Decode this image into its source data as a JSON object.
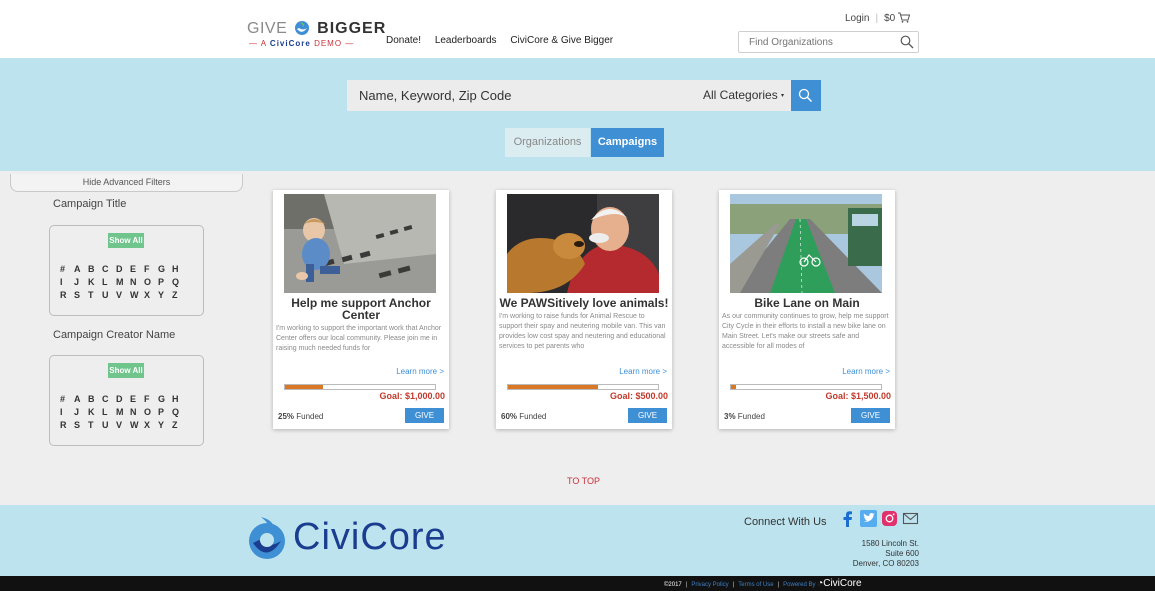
{
  "header": {
    "logo": {
      "give": "GIVE",
      "bigger": "BIGGER",
      "subtitle_prefix": "A",
      "subtitle_brand": "CiviCore",
      "subtitle_suffix": "DEMO"
    },
    "nav": [
      "Donate!",
      "Leaderboards",
      "CiviCore & Give Bigger"
    ],
    "login": "Login",
    "cart_total": "$0",
    "find_placeholder": "Find Organizations"
  },
  "hero": {
    "search_placeholder": "Name, Keyword, Zip Code",
    "category_value": "All Categories",
    "toggle": {
      "organizations": "Organizations",
      "campaigns": "Campaigns",
      "active": "campaigns"
    }
  },
  "filters": {
    "hide_label": "Hide Advanced Filters",
    "groups": [
      {
        "title": "Campaign Title",
        "show_all": "Show All",
        "rows": [
          [
            "#",
            "A",
            "B",
            "C",
            "D",
            "E",
            "F",
            "G",
            "H"
          ],
          [
            "I",
            "J",
            "K",
            "L",
            "M",
            "N",
            "O",
            "P",
            "Q"
          ],
          [
            "R",
            "S",
            "T",
            "U",
            "V",
            "W",
            "X",
            "Y",
            "Z"
          ]
        ]
      },
      {
        "title": "Campaign Creator Name",
        "show_all": "Show All",
        "rows": [
          [
            "#",
            "A",
            "B",
            "C",
            "D",
            "E",
            "F",
            "G",
            "H"
          ],
          [
            "I",
            "J",
            "K",
            "L",
            "M",
            "N",
            "O",
            "P",
            "Q"
          ],
          [
            "R",
            "S",
            "T",
            "U",
            "V",
            "W",
            "X",
            "Y",
            "Z"
          ]
        ]
      }
    ]
  },
  "campaigns": [
    {
      "title": "Help me support Anchor Center",
      "description": "I'm working to support the important work that Anchor Center offers our local community. Please join me in raising much needed funds for",
      "learn_more": "Learn more >",
      "progress_fraction": 0.25,
      "goal": "Goal: $1,000.00",
      "funded_pct": "25%",
      "funded_label": "Funded",
      "give": "GIVE"
    },
    {
      "title": "We PAWSitively love animals!",
      "description": "I'm working to raise funds for Animal Rescue to support their spay and neutering mobile van. This van provides low cost spay and neutering and educational services to pet parents who",
      "learn_more": "Learn more >",
      "progress_fraction": 0.6,
      "goal": "Goal: $500.00",
      "funded_pct": "60%",
      "funded_label": "Funded",
      "give": "GIVE"
    },
    {
      "title": "Bike Lane on Main",
      "description": "As our community continues to grow, help me support City Cycle in their efforts to install a new bike lane on Main Street. Let's make our streets safe and accessible for all modes of",
      "learn_more": "Learn more >",
      "progress_fraction": 0.03,
      "goal": "Goal: $1,500.00",
      "funded_pct": "3%",
      "funded_label": "Funded",
      "give": "GIVE"
    }
  ],
  "to_top": "TO TOP",
  "footer": {
    "brand": "CiviCore",
    "connect": "Connect With Us",
    "social_icons": [
      "facebook-icon",
      "twitter-icon",
      "instagram-icon",
      "email-icon"
    ],
    "address": [
      "1580 Lincoln St.",
      "Suite 600",
      "Denver, CO 80203"
    ],
    "legal": {
      "copyright": "©2017",
      "privacy": "Privacy Policy",
      "terms": "Terms of Use",
      "powered": "Powered By",
      "brand": "CiviCore"
    }
  },
  "colors": {
    "accent_blue": "#3f8fd5",
    "hero_bg": "#bde3ef",
    "show_all_green": "#6fc58c",
    "goal_red": "#c0392b",
    "progress_orange": "#d97826"
  }
}
